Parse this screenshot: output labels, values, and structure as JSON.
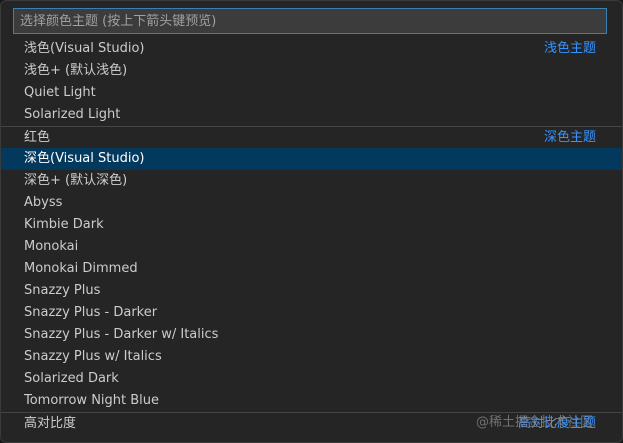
{
  "search": {
    "placeholder": "选择颜色主题 (按上下箭头键预览)"
  },
  "groups": {
    "light": "浅色主题",
    "dark": "深色主题",
    "high_contrast": "高对比度主题"
  },
  "themes": {
    "light": [
      "浅色(Visual Studio)",
      "浅色+ (默认浅色)",
      "Quiet Light",
      "Solarized Light"
    ],
    "dark": [
      "红色",
      "深色(Visual Studio)",
      "深色+ (默认深色)",
      "Abyss",
      "Kimbie Dark",
      "Monokai",
      "Monokai Dimmed",
      "Snazzy Plus",
      "Snazzy Plus - Darker",
      "Snazzy Plus - Darker w/ Italics",
      "Snazzy Plus w/ Italics",
      "Solarized Dark",
      "Tomorrow Night Blue"
    ],
    "high_contrast": [
      "高对比度"
    ]
  },
  "selected_theme": "深色(Visual Studio)",
  "watermark": "@稀土掘金技术社区",
  "colors": {
    "selection": "#04395e",
    "group_label": "#3794ff",
    "input_border": "#3c7fb1"
  }
}
